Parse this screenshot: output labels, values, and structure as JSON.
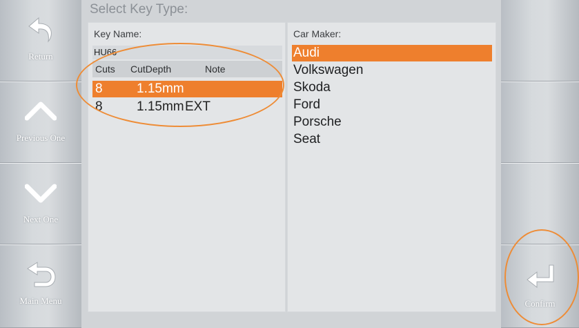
{
  "title": "Select Key Type:",
  "left_buttons": [
    {
      "label": "Return",
      "icon": "curved-arrow-back-icon"
    },
    {
      "label": "Previous One",
      "icon": "chevron-up-icon"
    },
    {
      "label": "Next One",
      "icon": "chevron-down-icon"
    },
    {
      "label": "Main Menu",
      "icon": "u-turn-back-icon"
    }
  ],
  "right_buttons": [
    {
      "label": "Confirm",
      "icon": "enter-return-icon"
    }
  ],
  "key_panel": {
    "label": "Key Name:",
    "key_name": "HU66",
    "columns": [
      "Cuts",
      "CutDepth",
      "Note"
    ],
    "rows": [
      {
        "cuts": "8",
        "depth": "1.15mm",
        "note": "",
        "selected": true
      },
      {
        "cuts": "8",
        "depth": "1.15mm",
        "note": "EXT",
        "selected": false
      }
    ]
  },
  "maker_panel": {
    "label": "Car Maker:",
    "items": [
      "Audi",
      "Volkswagen",
      "Skoda",
      "Ford",
      "Porsche",
      "Seat"
    ],
    "selected": "Audi"
  },
  "colors": {
    "accent": "#ee7f2d",
    "annotation_ring": "#ee8c36"
  }
}
